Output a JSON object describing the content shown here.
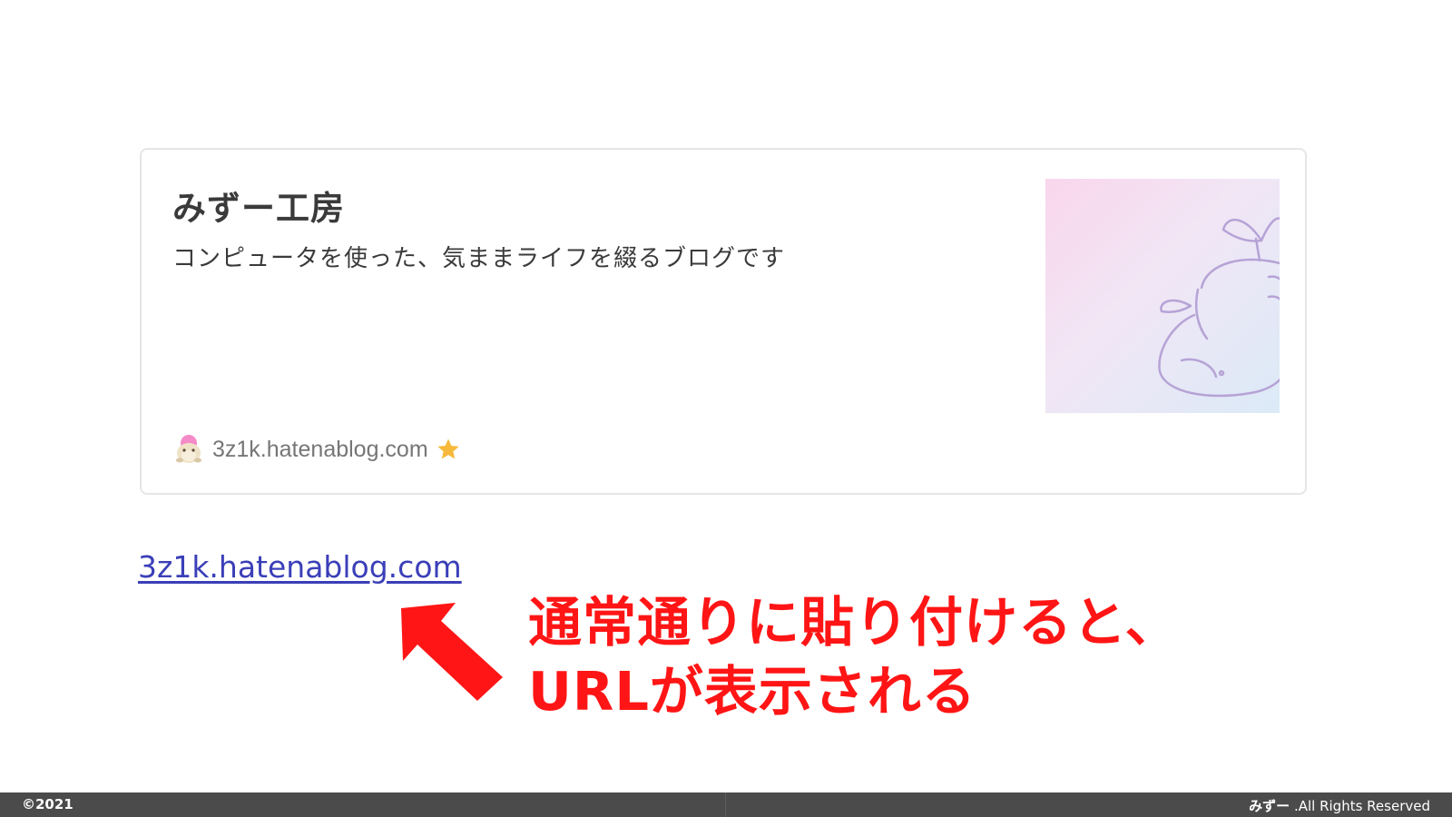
{
  "card": {
    "title": "みずー工房",
    "description": "コンピュータを使った、気ままライフを綴るブログです",
    "domain": "3z1k.hatenablog.com",
    "favicon_icon": "character-avatar-icon",
    "star_icon": "star-icon",
    "star_color": "#f6b93b"
  },
  "plain_link": {
    "text": "3z1k.hatenablog.com",
    "color": "#3b3fb8"
  },
  "annotation": {
    "line1": "通常通りに貼り付けると、",
    "line2": "URLが表示される",
    "color": "#ff1515",
    "arrow_icon": "arrow-up-left-icon"
  },
  "footer": {
    "copyright": "©2021",
    "author": "みずー",
    "rights": " .All Rights Reserved"
  }
}
